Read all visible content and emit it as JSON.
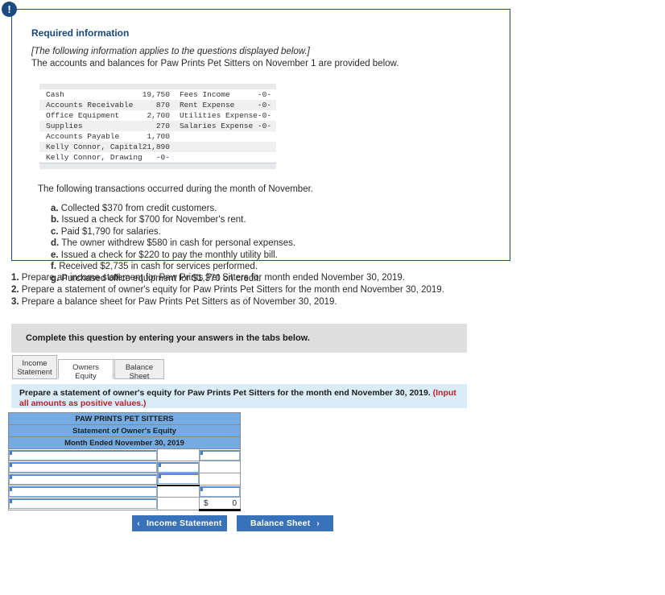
{
  "panel": {
    "alert_icon": "exclamation-icon",
    "title": "Required information",
    "lead_bracket": "[The following information applies to the questions displayed below.]",
    "lead_line2": "The accounts and balances for Paw Prints Pet Sitters on November 1 are provided below.",
    "accounts_table": {
      "rows": [
        {
          "name": "Cash",
          "amount": "19,750",
          "name2": "Fees Income",
          "amount2": "-0-"
        },
        {
          "name": "Accounts Receivable",
          "amount": "870",
          "name2": "Rent Expense",
          "amount2": "-0-"
        },
        {
          "name": "Office Equipment",
          "amount": "2,700",
          "name2": "Utilities Expense",
          "amount2": "-0-"
        },
        {
          "name": "Supplies",
          "amount": "270",
          "name2": "Salaries Expense",
          "amount2": "-0-"
        },
        {
          "name": "Accounts Payable",
          "amount": "1,700",
          "name2": "",
          "amount2": ""
        },
        {
          "name": "Kelly Connor, Capital",
          "amount": "21,890",
          "name2": "",
          "amount2": ""
        },
        {
          "name": "Kelly Connor, Drawing",
          "amount": "-0-",
          "name2": "",
          "amount2": ""
        }
      ]
    },
    "transactions_lead": "The following transactions occurred during the month of November.",
    "transactions": [
      {
        "letter": "a.",
        "text": "Collected $370 from credit customers."
      },
      {
        "letter": "b.",
        "text": "Issued a check for $700 for November's rent."
      },
      {
        "letter": "c.",
        "text": "Paid $1,790 for salaries."
      },
      {
        "letter": "d.",
        "text": "The owner withdrew $580 in cash for personal expenses."
      },
      {
        "letter": "e.",
        "text": "Issued a check for $220 to pay the monthly utility bill."
      },
      {
        "letter": "f.",
        "text": "Received $2,735 in cash for services performed."
      },
      {
        "letter": "g.",
        "text": "Purchased office equipment for $1,370 on credit."
      }
    ]
  },
  "requirements": [
    {
      "num": "1.",
      "text": "Prepare an income statement for Paw Prints Pet Sitters for month ended November 30, 2019."
    },
    {
      "num": "2.",
      "text": "Prepare a statement of owner's equity for Paw Prints Pet Sitters for the month end November 30, 2019."
    },
    {
      "num": "3.",
      "text": "Prepare a balance sheet for Paw Prints Pet Sitters as of November 30, 2019."
    }
  ],
  "banner": {
    "text": "Complete this question by entering your answers in the tabs below."
  },
  "tabs": [
    {
      "label": "Income\nStatement",
      "active": false
    },
    {
      "label": "Owners Equity",
      "active": true
    },
    {
      "label": "Balance Sheet",
      "active": false
    }
  ],
  "instruction": {
    "main": "Prepare a statement of owner's equity for Paw Prints Pet Sitters for the month end November 30, 2019. ",
    "red": "(Input all amounts as positive values.)"
  },
  "worksheet": {
    "header_line1": "PAW PRINTS PET SITTERS",
    "header_line2": "Statement of Owner's Equity",
    "header_line3": "Month Ended November 30, 2019",
    "header_color": "#74ABE2",
    "rows": [
      {
        "label_value": "",
        "mid_value": "",
        "right_value": "",
        "label_input": true,
        "mid_input": false,
        "right_input": true,
        "mid_heavy_top": false,
        "right_total": false
      },
      {
        "label_value": "",
        "mid_value": "",
        "right_value": "",
        "label_input": true,
        "mid_input": true,
        "right_input": false,
        "mid_heavy_top": false,
        "right_total": false
      },
      {
        "label_value": "",
        "mid_value": "",
        "right_value": "",
        "label_input": true,
        "mid_input": true,
        "right_input": false,
        "mid_heavy_top": false,
        "right_total": false
      },
      {
        "label_value": "",
        "mid_value": "",
        "right_value": "",
        "label_input": true,
        "mid_input": false,
        "right_input": true,
        "mid_heavy_top": true,
        "right_total": false
      },
      {
        "label_value": "",
        "mid_value": "",
        "right_value": "0",
        "label_input": true,
        "mid_input": false,
        "right_input": false,
        "mid_heavy_top": false,
        "right_total": true,
        "currency": "$"
      }
    ]
  },
  "nav": {
    "prev_label": "Income Statement",
    "next_label": "Balance Sheet",
    "prev_chevron": "‹",
    "next_chevron": "›",
    "button_color": "#3872b8"
  }
}
